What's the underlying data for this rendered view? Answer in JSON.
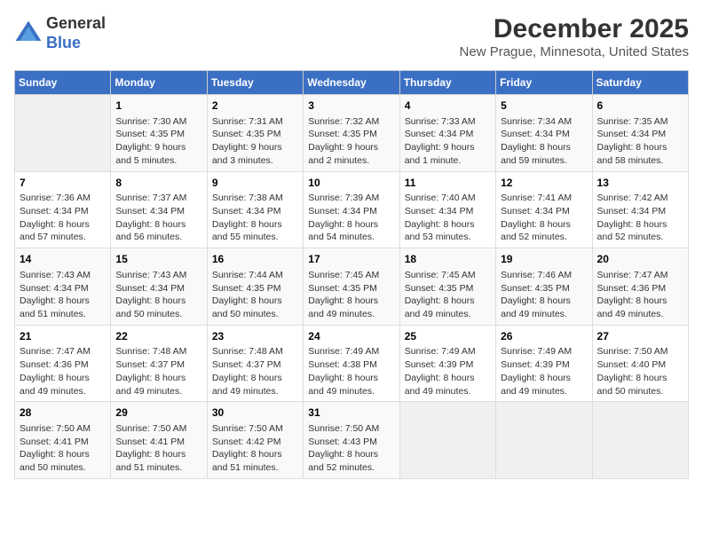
{
  "logo": {
    "line1": "General",
    "line2": "Blue"
  },
  "title": "December 2025",
  "subtitle": "New Prague, Minnesota, United States",
  "days_of_week": [
    "Sunday",
    "Monday",
    "Tuesday",
    "Wednesday",
    "Thursday",
    "Friday",
    "Saturday"
  ],
  "weeks": [
    [
      {
        "num": "",
        "info": ""
      },
      {
        "num": "1",
        "info": "Sunrise: 7:30 AM\nSunset: 4:35 PM\nDaylight: 9 hours\nand 5 minutes."
      },
      {
        "num": "2",
        "info": "Sunrise: 7:31 AM\nSunset: 4:35 PM\nDaylight: 9 hours\nand 3 minutes."
      },
      {
        "num": "3",
        "info": "Sunrise: 7:32 AM\nSunset: 4:35 PM\nDaylight: 9 hours\nand 2 minutes."
      },
      {
        "num": "4",
        "info": "Sunrise: 7:33 AM\nSunset: 4:34 PM\nDaylight: 9 hours\nand 1 minute."
      },
      {
        "num": "5",
        "info": "Sunrise: 7:34 AM\nSunset: 4:34 PM\nDaylight: 8 hours\nand 59 minutes."
      },
      {
        "num": "6",
        "info": "Sunrise: 7:35 AM\nSunset: 4:34 PM\nDaylight: 8 hours\nand 58 minutes."
      }
    ],
    [
      {
        "num": "7",
        "info": "Sunrise: 7:36 AM\nSunset: 4:34 PM\nDaylight: 8 hours\nand 57 minutes."
      },
      {
        "num": "8",
        "info": "Sunrise: 7:37 AM\nSunset: 4:34 PM\nDaylight: 8 hours\nand 56 minutes."
      },
      {
        "num": "9",
        "info": "Sunrise: 7:38 AM\nSunset: 4:34 PM\nDaylight: 8 hours\nand 55 minutes."
      },
      {
        "num": "10",
        "info": "Sunrise: 7:39 AM\nSunset: 4:34 PM\nDaylight: 8 hours\nand 54 minutes."
      },
      {
        "num": "11",
        "info": "Sunrise: 7:40 AM\nSunset: 4:34 PM\nDaylight: 8 hours\nand 53 minutes."
      },
      {
        "num": "12",
        "info": "Sunrise: 7:41 AM\nSunset: 4:34 PM\nDaylight: 8 hours\nand 52 minutes."
      },
      {
        "num": "13",
        "info": "Sunrise: 7:42 AM\nSunset: 4:34 PM\nDaylight: 8 hours\nand 52 minutes."
      }
    ],
    [
      {
        "num": "14",
        "info": "Sunrise: 7:43 AM\nSunset: 4:34 PM\nDaylight: 8 hours\nand 51 minutes."
      },
      {
        "num": "15",
        "info": "Sunrise: 7:43 AM\nSunset: 4:34 PM\nDaylight: 8 hours\nand 50 minutes."
      },
      {
        "num": "16",
        "info": "Sunrise: 7:44 AM\nSunset: 4:35 PM\nDaylight: 8 hours\nand 50 minutes."
      },
      {
        "num": "17",
        "info": "Sunrise: 7:45 AM\nSunset: 4:35 PM\nDaylight: 8 hours\nand 49 minutes."
      },
      {
        "num": "18",
        "info": "Sunrise: 7:45 AM\nSunset: 4:35 PM\nDaylight: 8 hours\nand 49 minutes."
      },
      {
        "num": "19",
        "info": "Sunrise: 7:46 AM\nSunset: 4:35 PM\nDaylight: 8 hours\nand 49 minutes."
      },
      {
        "num": "20",
        "info": "Sunrise: 7:47 AM\nSunset: 4:36 PM\nDaylight: 8 hours\nand 49 minutes."
      }
    ],
    [
      {
        "num": "21",
        "info": "Sunrise: 7:47 AM\nSunset: 4:36 PM\nDaylight: 8 hours\nand 49 minutes."
      },
      {
        "num": "22",
        "info": "Sunrise: 7:48 AM\nSunset: 4:37 PM\nDaylight: 8 hours\nand 49 minutes."
      },
      {
        "num": "23",
        "info": "Sunrise: 7:48 AM\nSunset: 4:37 PM\nDaylight: 8 hours\nand 49 minutes."
      },
      {
        "num": "24",
        "info": "Sunrise: 7:49 AM\nSunset: 4:38 PM\nDaylight: 8 hours\nand 49 minutes."
      },
      {
        "num": "25",
        "info": "Sunrise: 7:49 AM\nSunset: 4:39 PM\nDaylight: 8 hours\nand 49 minutes."
      },
      {
        "num": "26",
        "info": "Sunrise: 7:49 AM\nSunset: 4:39 PM\nDaylight: 8 hours\nand 49 minutes."
      },
      {
        "num": "27",
        "info": "Sunrise: 7:50 AM\nSunset: 4:40 PM\nDaylight: 8 hours\nand 50 minutes."
      }
    ],
    [
      {
        "num": "28",
        "info": "Sunrise: 7:50 AM\nSunset: 4:41 PM\nDaylight: 8 hours\nand 50 minutes."
      },
      {
        "num": "29",
        "info": "Sunrise: 7:50 AM\nSunset: 4:41 PM\nDaylight: 8 hours\nand 51 minutes."
      },
      {
        "num": "30",
        "info": "Sunrise: 7:50 AM\nSunset: 4:42 PM\nDaylight: 8 hours\nand 51 minutes."
      },
      {
        "num": "31",
        "info": "Sunrise: 7:50 AM\nSunset: 4:43 PM\nDaylight: 8 hours\nand 52 minutes."
      },
      {
        "num": "",
        "info": ""
      },
      {
        "num": "",
        "info": ""
      },
      {
        "num": "",
        "info": ""
      }
    ]
  ]
}
